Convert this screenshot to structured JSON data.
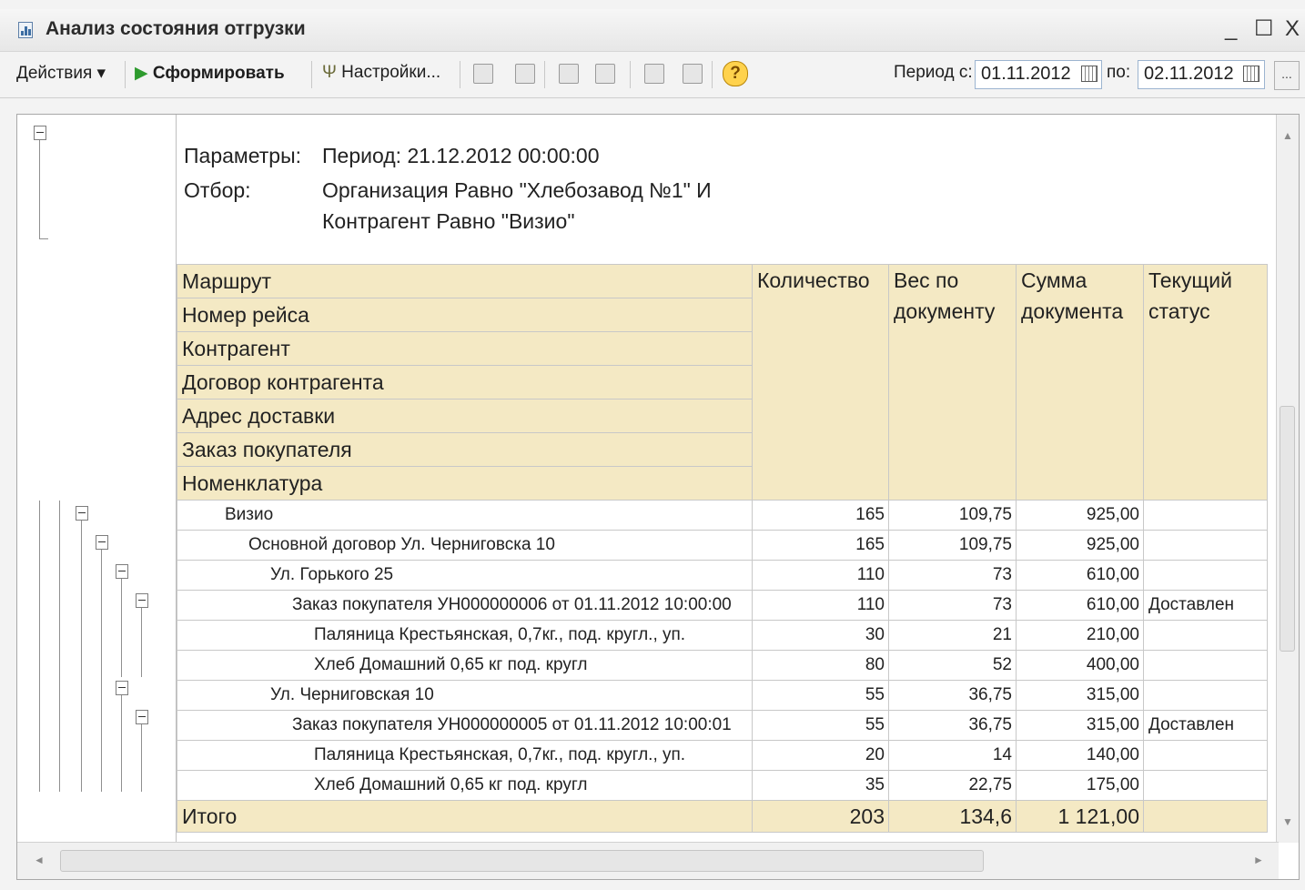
{
  "window": {
    "title": "Анализ состояния отгрузки",
    "minimize": "_",
    "maximize": "☐",
    "close": "X"
  },
  "toolbar": {
    "actions": "Действия ▾",
    "generate": "Сформировать",
    "settings": "Настройки...",
    "period_from_label": "Период с:",
    "period_from_value": "01.11.2012",
    "period_to_label": "по:",
    "period_to_value": "02.11.2012",
    "more": "...",
    "help": "?"
  },
  "params": {
    "label": "Параметры:",
    "period": "Период: 21.12.2012 00:00:00",
    "filter_label": "Отбор:",
    "filter_line1": "Организация Равно \"Хлебозавод №1\" И",
    "filter_line2": "Контрагент Равно \"Визио\""
  },
  "headers": {
    "groups": [
      "Маршрут",
      "Номер рейса",
      "Контрагент",
      "Договор контрагента",
      "Адрес доставки",
      "Заказ покупателя",
      "Номенклатура"
    ],
    "qty": "Количество",
    "weight": "Вес по документу",
    "sum": "Сумма документа",
    "status": "Текущий статус"
  },
  "rows": [
    {
      "name": "Визио",
      "qty": "165",
      "weight": "109,75",
      "sum": "925,00",
      "status": ""
    },
    {
      "name": "Основной договор Ул. Черниговска 10",
      "qty": "165",
      "weight": "109,75",
      "sum": "925,00",
      "status": ""
    },
    {
      "name": "Ул. Горького 25",
      "qty": "110",
      "weight": "73",
      "sum": "610,00",
      "status": ""
    },
    {
      "name": "Заказ покупателя УН000000006 от 01.11.2012 10:00:00",
      "qty": "110",
      "weight": "73",
      "sum": "610,00",
      "status": "Доставлен"
    },
    {
      "name": "Паляница Крестьянская, 0,7кг., под. кругл., уп.",
      "qty": "30",
      "weight": "21",
      "sum": "210,00",
      "status": ""
    },
    {
      "name": "Хлеб Домашний 0,65 кг под. кругл",
      "qty": "80",
      "weight": "52",
      "sum": "400,00",
      "status": ""
    },
    {
      "name": "Ул. Черниговская 10",
      "qty": "55",
      "weight": "36,75",
      "sum": "315,00",
      "status": ""
    },
    {
      "name": "Заказ покупателя УН000000005 от 01.11.2012 10:00:01",
      "qty": "55",
      "weight": "36,75",
      "sum": "315,00",
      "status": "Доставлен"
    },
    {
      "name": "Паляница Крестьянская, 0,7кг., под. кругл., уп.",
      "qty": "20",
      "weight": "14",
      "sum": "140,00",
      "status": ""
    },
    {
      "name": "Хлеб Домашний 0,65 кг под. кругл",
      "qty": "35",
      "weight": "22,75",
      "sum": "175,00",
      "status": ""
    }
  ],
  "total": {
    "label": "Итого",
    "qty": "203",
    "weight": "134,6",
    "sum": "1 121,00"
  },
  "colors": {
    "header_bg": "#f4e9c4",
    "grid": "#c8c8c8"
  },
  "icons": [
    "play-icon",
    "wrench-icon",
    "print-icon",
    "chart-icon",
    "filter-icon",
    "table-icon",
    "export-icon",
    "save-icon",
    "help-icon",
    "calendar-icon"
  ]
}
